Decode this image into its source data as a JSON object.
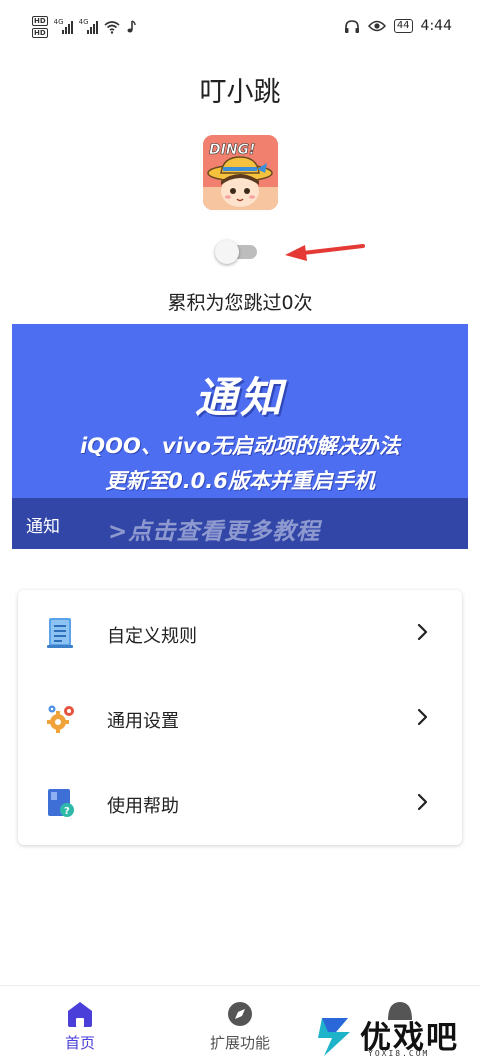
{
  "status_bar": {
    "hd_badges": [
      "HD",
      "HD"
    ],
    "signal_labels": [
      "4G",
      "4G"
    ],
    "battery": "44",
    "time": "4:44",
    "icons": [
      "wifi-icon",
      "music-note-icon",
      "headphones-icon",
      "eye-icon"
    ]
  },
  "app": {
    "title": "叮小跳",
    "avatar_text": "DING!",
    "service_enabled": false,
    "skip_counter": "累积为您跳过0次"
  },
  "banner": {
    "heading": "通知",
    "line1": "iQOO、vivo无启动项的解决办法",
    "line2": "更新至0.0.6版本并重启手机",
    "footer_tag": "通知",
    "footer_more": ">点击查看更多教程"
  },
  "menu": {
    "items": [
      {
        "label": "自定义规则",
        "icon": "document-list-icon"
      },
      {
        "label": "通用设置",
        "icon": "gears-icon"
      },
      {
        "label": "使用帮助",
        "icon": "help-book-icon"
      }
    ]
  },
  "bottom_nav": {
    "items": [
      {
        "label": "首页",
        "icon": "home-icon",
        "active": true
      },
      {
        "label": "扩展功能",
        "icon": "compass-icon",
        "active": false
      }
    ]
  },
  "watermark": {
    "text": "优戏吧",
    "sub": "YOXI8.COM"
  },
  "colors": {
    "banner_bg": "#4d6ef0",
    "accent": "#4a3fd8",
    "arrow": "#e53935"
  }
}
